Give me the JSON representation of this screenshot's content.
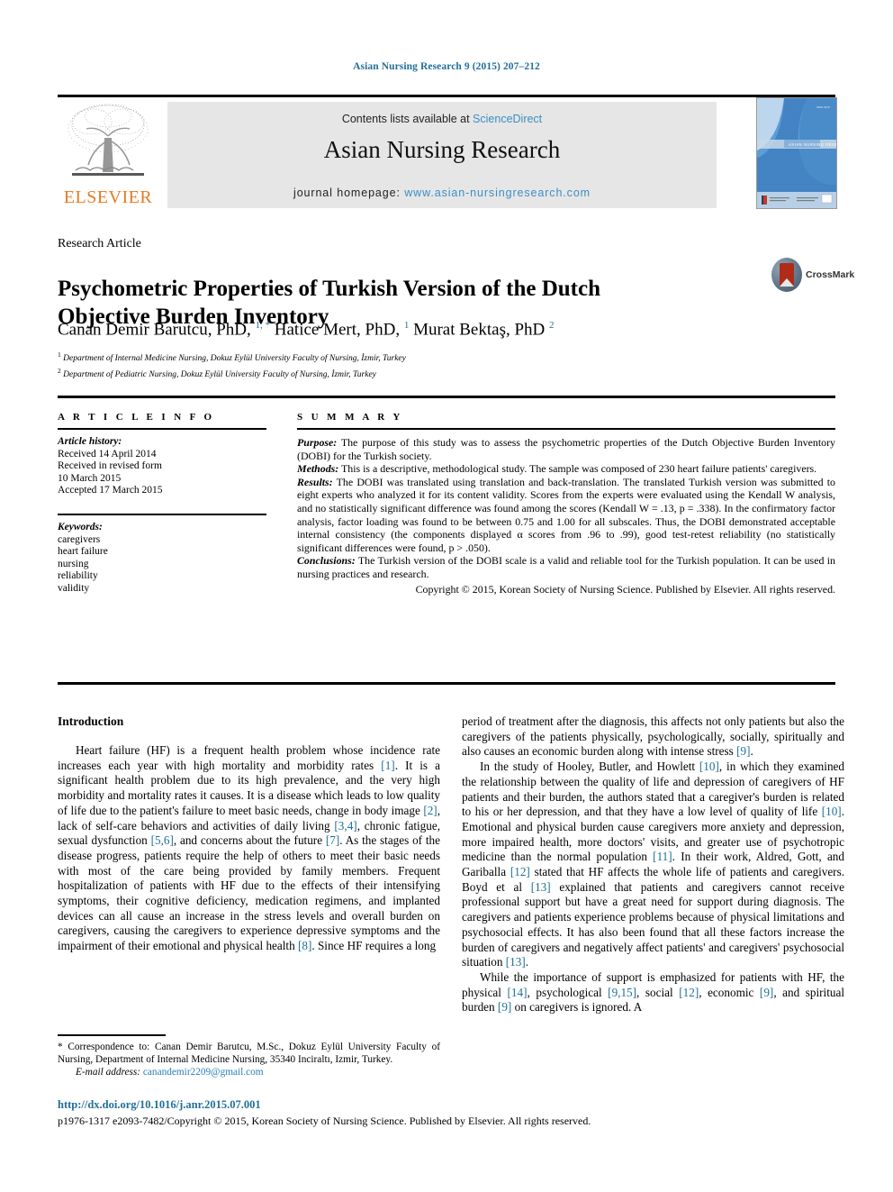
{
  "running_head": "Asian Nursing Research 9 (2015) 207–212",
  "masthead": {
    "contents_prefix": "Contents lists available at ",
    "contents_link": "ScienceDirect",
    "journal_name": "Asian Nursing Research",
    "homepage_label": "journal homepage: ",
    "homepage_url": "www.asian-nursingresearch.com",
    "publisher_logo_text": "ELSEVIER",
    "cover_title": "ASIAN NURSING RESEARCH"
  },
  "article": {
    "type": "Research Article",
    "title": "Psychometric Properties of Turkish Version of the Dutch Objective Burden Inventory",
    "crossmark_label": "CrossMark",
    "authors": "Canan Demir Barutcu, PhD, 1, * Hatice Mert, PhD, 1 Murat Bektaş, PhD 2",
    "affiliation_1": "Department of Internal Medicine Nursing, Dokuz Eylül University Faculty of Nursing, İzmir, Turkey",
    "affiliation_2": "Department of Pediatric Nursing, Dokuz Eylül University Faculty of Nursing, İzmir, Turkey"
  },
  "article_info": {
    "heading": "A R T I C L E   I N F O",
    "history_label": "Article history:",
    "history_lines": [
      "Received 14 April 2014",
      "Received in revised form",
      "10 March 2015",
      "Accepted 17 March 2015"
    ],
    "keywords_label": "Keywords:",
    "keywords": [
      "caregivers",
      "heart failure",
      "nursing",
      "reliability",
      "validity"
    ]
  },
  "summary": {
    "heading": "S U M M A R Y",
    "purpose_label": "Purpose:",
    "purpose_text": " The purpose of this study was to assess the psychometric properties of the Dutch Objective Burden Inventory (DOBI) for the Turkish society.",
    "methods_label": "Methods:",
    "methods_text": " This is a descriptive, methodological study. The sample was composed of 230 heart failure patients' caregivers.",
    "results_label": "Results:",
    "results_text": " The DOBI was translated using translation and back-translation. The translated Turkish version was submitted to eight experts who analyzed it for its content validity. Scores from the experts were evaluated using the Kendall W analysis, and no statistically significant difference was found among the scores (Kendall W = .13, p = .338). In the confirmatory factor analysis, factor loading was found to be between 0.75 and 1.00 for all subscales. Thus, the DOBI demonstrated acceptable internal consistency (the components displayed α scores from .96 to .99), good test-retest reliability (no statistically significant differences were found, p > .050).",
    "conclusions_label": "Conclusions:",
    "conclusions_text": " The Turkish version of the DOBI scale is a valid and reliable tool for the Turkish population. It can be used in nursing practices and research.",
    "copyright": "Copyright © 2015, Korean Society of Nursing Science. Published by Elsevier. All rights reserved."
  },
  "body": {
    "intro_heading": "Introduction",
    "left_paragraphs": [
      "Heart failure (HF) is a frequent health problem whose incidence rate increases each year with high mortality and morbidity rates [1]. It is a significant health problem due to its high prevalence, and the very high morbidity and mortality rates it causes. It is a disease which leads to low quality of life due to the patient's failure to meet basic needs, change in body image [2], lack of self-care behaviors and activities of daily living [3,4], chronic fatigue, sexual dysfunction [5,6], and concerns about the future [7]. As the stages of the disease progress, patients require the help of others to meet their basic needs with most of the care being provided by family members. Frequent hospitalization of patients with HF due to the effects of their intensifying symptoms, their cognitive deficiency, medication regimens, and implanted devices can all cause an increase in the stress levels and overall burden on caregivers, causing the caregivers to experience depressive symptoms and the impairment of their emotional and physical health [8]. Since HF requires a long"
    ],
    "right_paragraphs": [
      "period of treatment after the diagnosis, this affects not only patients but also the caregivers of the patients physically, psychologically, socially, spiritually and also causes an economic burden along with intense stress [9].",
      "In the study of Hooley, Butler, and Howlett [10], in which they examined the relationship between the quality of life and depression of caregivers of HF patients and their burden, the authors stated that a caregiver's burden is related to his or her depression, and that they have a low level of quality of life [10]. Emotional and physical burden cause caregivers more anxiety and depression, more impaired health, more doctors' visits, and greater use of psychotropic medicine than the normal population [11]. In their work, Aldred, Gott, and Gariballa [12] stated that HF affects the whole life of patients and caregivers. Boyd et al [13] explained that patients and caregivers cannot receive professional support but have a great need for support during diagnosis. The caregivers and patients experience problems because of physical limitations and psychosocial effects. It has also been found that all these factors increase the burden of caregivers and negatively affect patients' and caregivers' psychosocial situation [13].",
      "While the importance of support is emphasized for patients with HF, the physical [14], psychological [9,15], social [12], economic [9], and spiritual burden [9] on caregivers is ignored. A"
    ]
  },
  "footnote": {
    "correspondence": "* Correspondence to: Canan Demir Barutcu, M.Sc., Dokuz Eylül University Faculty of Nursing, Department of Internal Medicine Nursing, 35340 Inciraltı, Izmir, Turkey.",
    "email_label": "E-mail address:",
    "email": "canandemir2209@gmail.com"
  },
  "footer": {
    "doi": "http://dx.doi.org/10.1016/j.anr.2015.07.001",
    "issn_copyright": "p1976-1317 e2093-7482/Copyright © 2015, Korean Society of Nursing Science. Published by Elsevier. All rights reserved."
  },
  "colors": {
    "link_blue": "#1f6f9a",
    "sciencedirect_blue": "#3a8fc4",
    "elsevier_orange": "#e87a22",
    "panel_grey": "#e6e6e6",
    "crossmark_red": "#b02b18"
  }
}
